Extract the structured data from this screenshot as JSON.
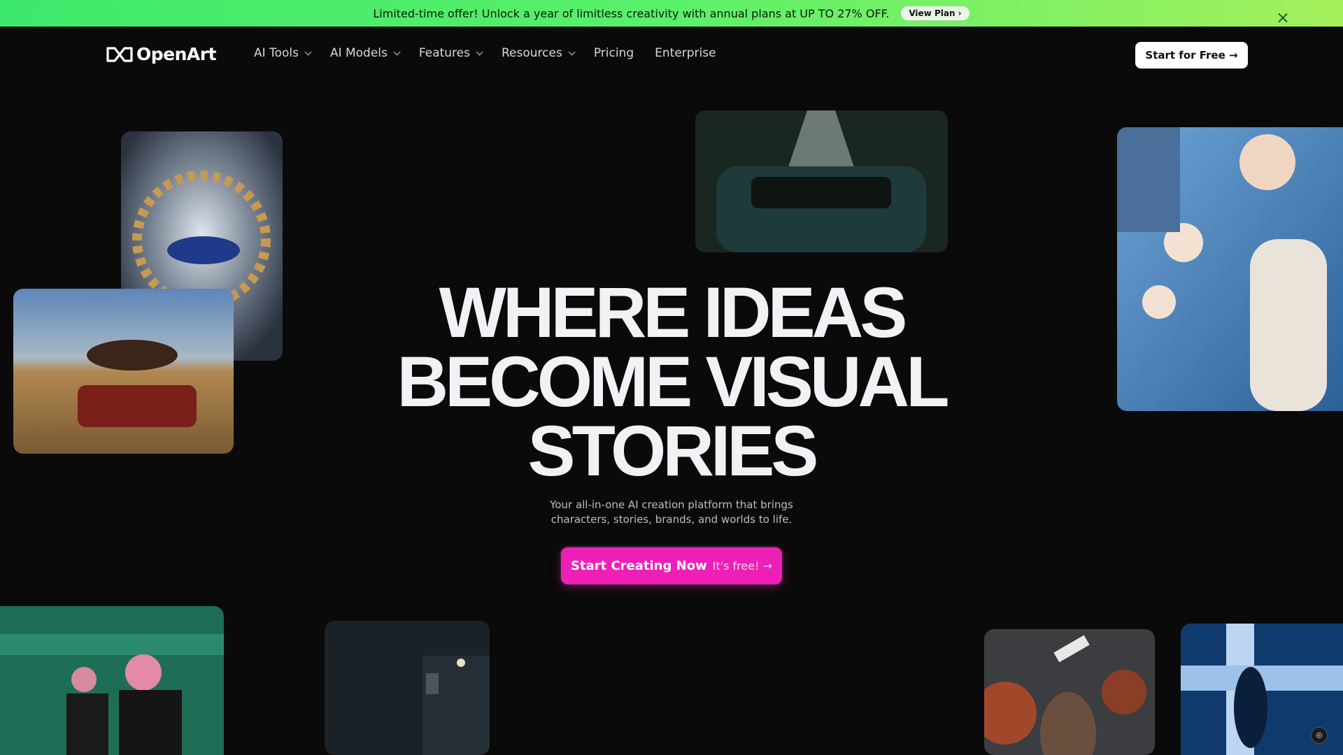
{
  "promo": {
    "text": "Limited-time offer! Unlock a year of limitless creativity with annual plans at UP TO 27% OFF.",
    "view_plan": "View Plan ›"
  },
  "nav": {
    "logo": "OpenArt",
    "items": [
      {
        "label": "AI Tools",
        "dropdown": true
      },
      {
        "label": "AI Models",
        "dropdown": true
      },
      {
        "label": "Features",
        "dropdown": true
      },
      {
        "label": "Resources",
        "dropdown": true
      },
      {
        "label": "Pricing",
        "dropdown": false
      },
      {
        "label": "Enterprise",
        "dropdown": false
      }
    ],
    "cta": "Start for Free →"
  },
  "hero": {
    "title_lines": [
      "WHERE IDEAS",
      "BECOME VISUAL",
      "STORIES"
    ],
    "subtitle_line1": "Your all-in-one AI creation platform that brings",
    "subtitle_line2": "characters, stories, brands, and worlds to life.",
    "cta_main": "Start Creating Now",
    "cta_free": "It's free! →"
  },
  "colors": {
    "background": "#0a0a0a",
    "banner_green": "#4ded66",
    "cta_pink": "#ee1fb7"
  }
}
